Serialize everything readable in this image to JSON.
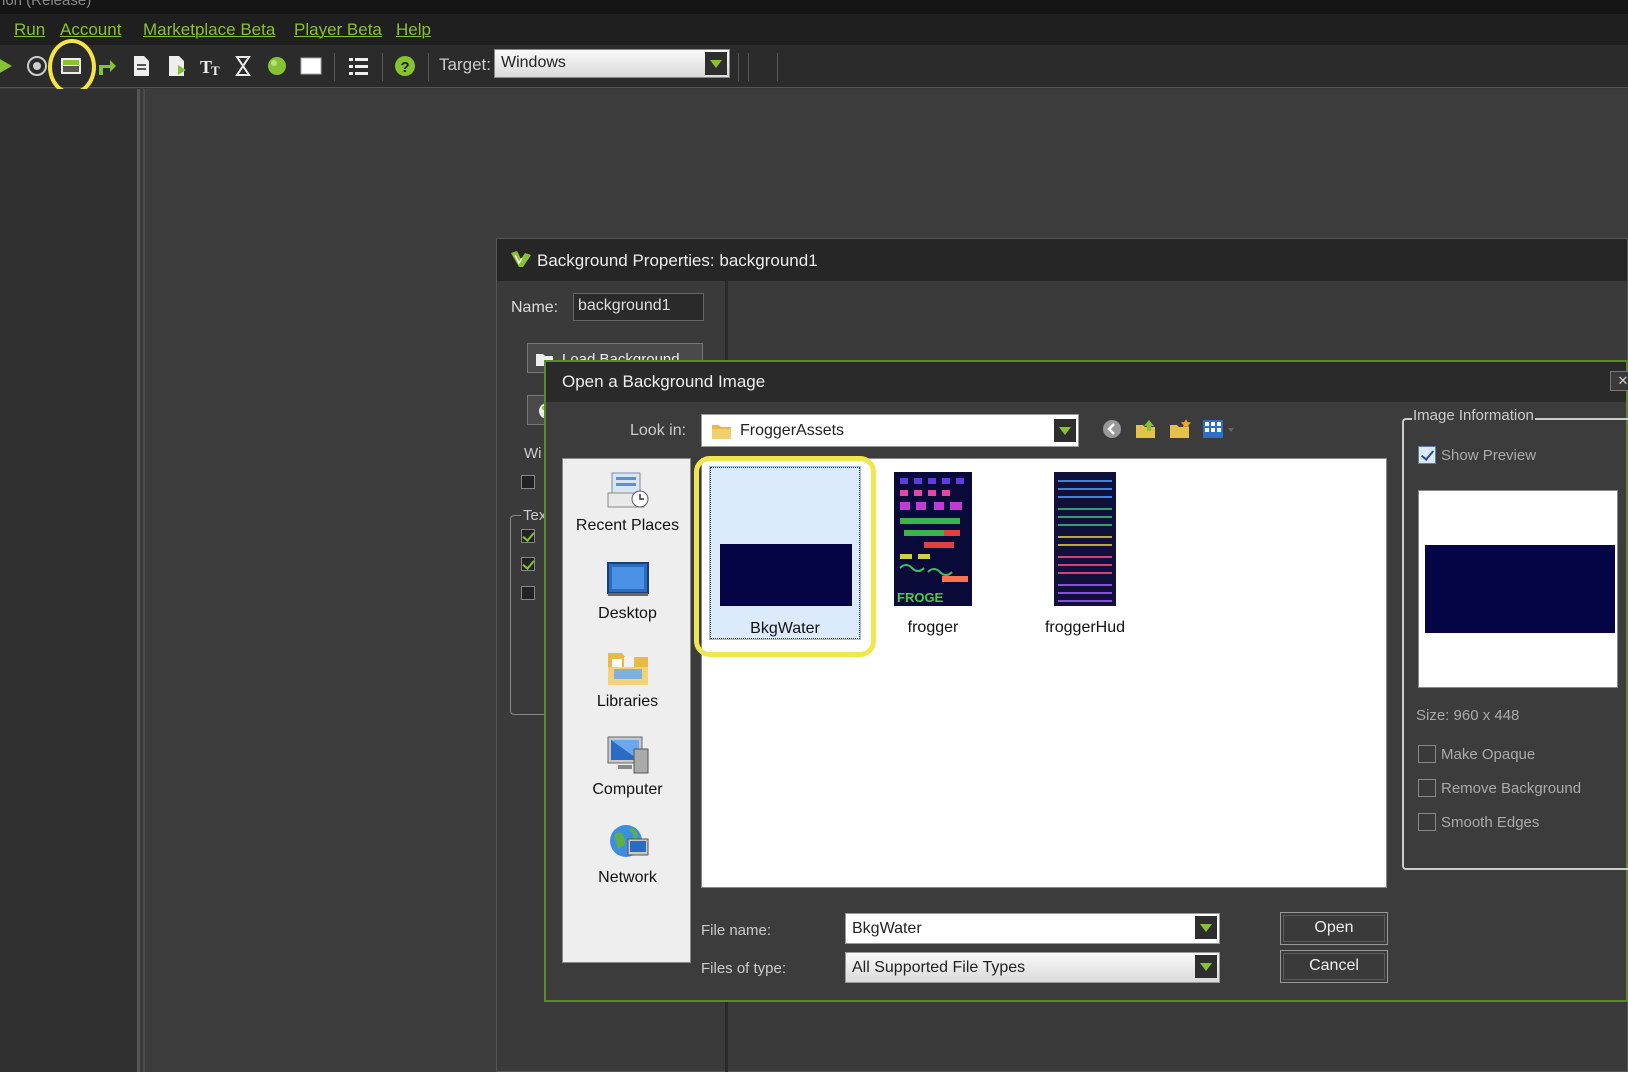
{
  "titlebar": {
    "text": "ion (Release)"
  },
  "menu": {
    "items": [
      "Run",
      "Account",
      "Marketplace Beta",
      "Player Beta",
      "Help"
    ]
  },
  "toolbar": {
    "target_label": "Target:",
    "target_value": "Windows",
    "icons": [
      "run-icon",
      "debug-icon",
      "create-background-icon",
      "create-path-icon",
      "create-script-icon",
      "create-shader-icon",
      "create-font-icon",
      "create-timeline-icon",
      "create-object-icon",
      "create-room-icon",
      "game-settings-icon",
      "help-icon"
    ]
  },
  "bg_props": {
    "title": "Background Properties: background1",
    "name_label": "Name:",
    "name_value": "background1",
    "load_button": "Load Background",
    "width_label": "Wi",
    "group_label": "Tex"
  },
  "open_dialog": {
    "title": "Open a Background Image",
    "close": "✕",
    "lookin_label": "Look in:",
    "lookin_value": "FroggerAssets",
    "places": [
      "Recent Places",
      "Desktop",
      "Libraries",
      "Computer",
      "Network"
    ],
    "files": [
      {
        "name": "BkgWater",
        "selected": true
      },
      {
        "name": "frogger",
        "selected": false
      },
      {
        "name": "froggerHud",
        "selected": false
      }
    ],
    "filename_label": "File name:",
    "filename_value": "BkgWater",
    "filetype_label": "Files of type:",
    "filetype_value": "All Supported File Types",
    "open_button": "Open",
    "cancel_button": "Cancel",
    "image_info": {
      "label": "Image Information",
      "show_preview": "Show Preview",
      "show_preview_checked": true,
      "size": "Size: 960 x 448",
      "make_opaque": "Make Opaque",
      "remove_background": "Remove Background",
      "smooth_edges": "Smooth Edges"
    }
  },
  "colors": {
    "accent": "#86c232",
    "highlight": "#f2e44a",
    "water": "#050545"
  }
}
